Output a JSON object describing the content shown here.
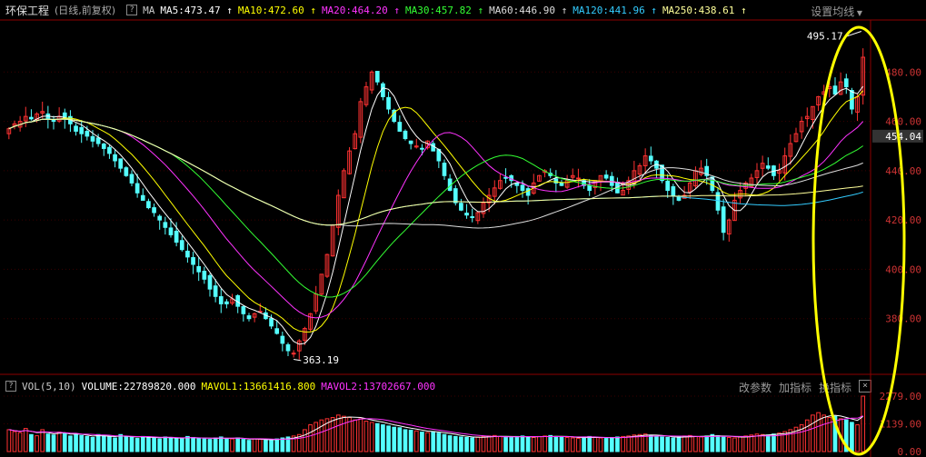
{
  "header": {
    "stock_name": "环保工程",
    "mode": "(日线,前复权)",
    "ma_label": "MA",
    "ma_items": [
      {
        "label": "MA5:473.47",
        "color": "#ffffff"
      },
      {
        "label": "MA10:472.60",
        "color": "#ffff00"
      },
      {
        "label": "MA20:464.20",
        "color": "#ff33ff"
      },
      {
        "label": "MA30:457.82",
        "color": "#33ff33"
      },
      {
        "label": "MA60:446.90",
        "color": "#dddddd"
      },
      {
        "label": "MA120:441.96",
        "color": "#33ccff"
      },
      {
        "label": "MA250:438.61",
        "color": "#ffff99"
      }
    ],
    "settings_label": "设置均线"
  },
  "volume_header": {
    "label": "VOL(5,10)",
    "volume": "VOLUME:22789820.000",
    "mavol1": "MAVOL1:13661416.800",
    "mavol2": "MAVOL2:13702667.000",
    "buttons": [
      "改参数",
      "加指标",
      "换指标"
    ]
  },
  "price_axis": {
    "ticks": [
      "480.00",
      "460.00",
      "440.00",
      "420.00",
      "400.00",
      "380.00"
    ],
    "current": "454.04"
  },
  "volume_axis": {
    "ticks": [
      "2279.00",
      "1139.00",
      "0.00"
    ]
  },
  "annotations": {
    "high": "495.17",
    "low": "363.19"
  },
  "chart_data": {
    "type": "candlestick",
    "title": "环保工程",
    "ylim": [
      360,
      500
    ],
    "volume_ylim": [
      0,
      2279
    ],
    "close": [
      457,
      459,
      460,
      462,
      461,
      463,
      464,
      461,
      460,
      462,
      461,
      459,
      456,
      455,
      454,
      452,
      451,
      449,
      447,
      444,
      441,
      438,
      435,
      431,
      428,
      425,
      423,
      420,
      417,
      414,
      411,
      408,
      405,
      402,
      399,
      396,
      392,
      389,
      386,
      386,
      388,
      385,
      382,
      380,
      382,
      383,
      380,
      377,
      374,
      370,
      367,
      366,
      371,
      376,
      382,
      390,
      398,
      406,
      418,
      430,
      440,
      448,
      455,
      468,
      474,
      480,
      476,
      470,
      465,
      460,
      456,
      453,
      451,
      450,
      449,
      452,
      448,
      444,
      438,
      432,
      427,
      424,
      422,
      421,
      423,
      427,
      430,
      433,
      436,
      437,
      436,
      434,
      432,
      430,
      435,
      438,
      440,
      438,
      435,
      434,
      436,
      438,
      437,
      434,
      432,
      436,
      438,
      437,
      434,
      431,
      432,
      436,
      440,
      442,
      446,
      444,
      441,
      436,
      432,
      430,
      428,
      430,
      435,
      440,
      441,
      438,
      432,
      424,
      415,
      420,
      428,
      432,
      435,
      437,
      440,
      443,
      441,
      438,
      440,
      446,
      451,
      455,
      460,
      462,
      466,
      470,
      472,
      474,
      471,
      476,
      474,
      465,
      470,
      486
    ],
    "volume": [
      900,
      820,
      780,
      950,
      700,
      650,
      900,
      720,
      680,
      800,
      760,
      640,
      700,
      660,
      620,
      580,
      700,
      650,
      600,
      560,
      700,
      620,
      580,
      540,
      620,
      600,
      560,
      520,
      600,
      580,
      540,
      520,
      620,
      580,
      540,
      520,
      500,
      560,
      600,
      540,
      520,
      560,
      500,
      460,
      520,
      500,
      480,
      460,
      520,
      560,
      600,
      640,
      700,
      900,
      1100,
      1200,
      1300,
      1350,
      1400,
      1500,
      1450,
      1400,
      1300,
      1350,
      1250,
      1200,
      1150,
      1100,
      1050,
      1000,
      980,
      900,
      880,
      850,
      800,
      780,
      820,
      760,
      700,
      650,
      620,
      600,
      580,
      560,
      600,
      620,
      640,
      660,
      620,
      600,
      580,
      620,
      640,
      600,
      580,
      620,
      640,
      660,
      620,
      600,
      580,
      560,
      540,
      600,
      620,
      580,
      560,
      540,
      580,
      600,
      620,
      640,
      680,
      700,
      720,
      660,
      620,
      600,
      580,
      560,
      600,
      640,
      660,
      620,
      600,
      640,
      700,
      650,
      600,
      580,
      560,
      600,
      640,
      680,
      720,
      700,
      680,
      720,
      760,
      820,
      900,
      1000,
      1100,
      1300,
      1500,
      1600,
      1500,
      1400,
      1450,
      1350,
      1300,
      1200,
      1100,
      2279
    ]
  }
}
